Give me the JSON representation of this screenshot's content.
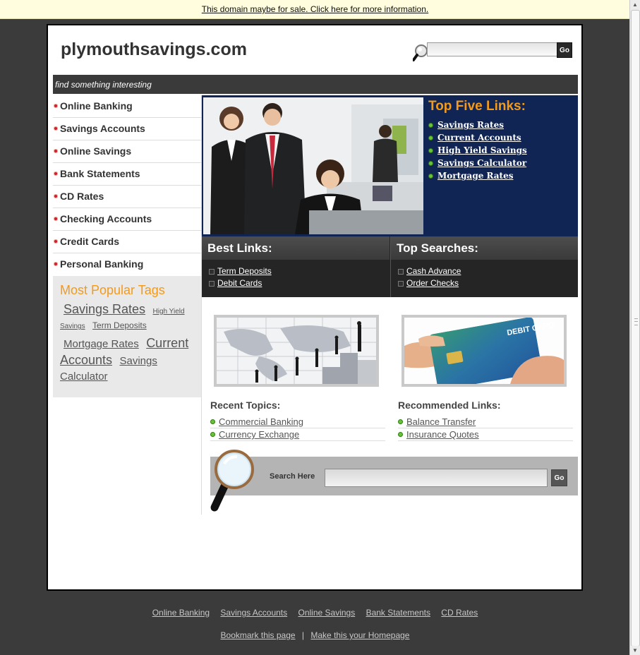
{
  "banner": {
    "text": "This domain maybe for sale. Click here for more information."
  },
  "header": {
    "site_title": "plymouthsavings.com",
    "search_button": "Go"
  },
  "tagline": "find something interesting",
  "nav": {
    "items": [
      "Online Banking",
      "Savings Accounts",
      "Online Savings",
      "Bank Statements",
      "CD Rates",
      "Checking Accounts",
      "Credit Cards",
      "Personal Banking"
    ]
  },
  "tags": {
    "title": "Most Popular Tags",
    "items": [
      "Savings Rates",
      "High Yield Savings",
      "Term Deposits",
      "Mortgage Rates",
      "Current Accounts",
      "Savings Calculator"
    ]
  },
  "top_five": {
    "title": "Top Five Links:",
    "links": [
      "Savings Rates",
      "Current Accounts",
      "High Yield Savings",
      "Savings Calculator",
      "Mortgage Rates"
    ]
  },
  "best_links": {
    "title": "Best Links:",
    "links": [
      "Term Deposits",
      "Debit Cards"
    ]
  },
  "top_searches": {
    "title": "Top Searches:",
    "links": [
      "Cash Advance",
      "Order Checks"
    ]
  },
  "debit_card_text": "DEBIT CARD",
  "recent_topics": {
    "title": "Recent Topics:",
    "links": [
      "Commercial Banking",
      "Currency Exchange"
    ]
  },
  "recommended": {
    "title": "Recommended Links:",
    "links": [
      "Balance Transfer",
      "Insurance Quotes"
    ]
  },
  "bottom_search": {
    "label": "Search Here",
    "button": "Go"
  },
  "footer": {
    "links": [
      "Online Banking",
      "Savings Accounts",
      "Online Savings",
      "Bank Statements",
      "CD Rates"
    ],
    "bookmark": "Bookmark this page",
    "separator": "|",
    "homepage": "Make this your Homepage"
  },
  "colors": {
    "accent_orange": "#f39a1b",
    "hero_navy": "#102554",
    "page_bg": "#3b3b3b"
  }
}
